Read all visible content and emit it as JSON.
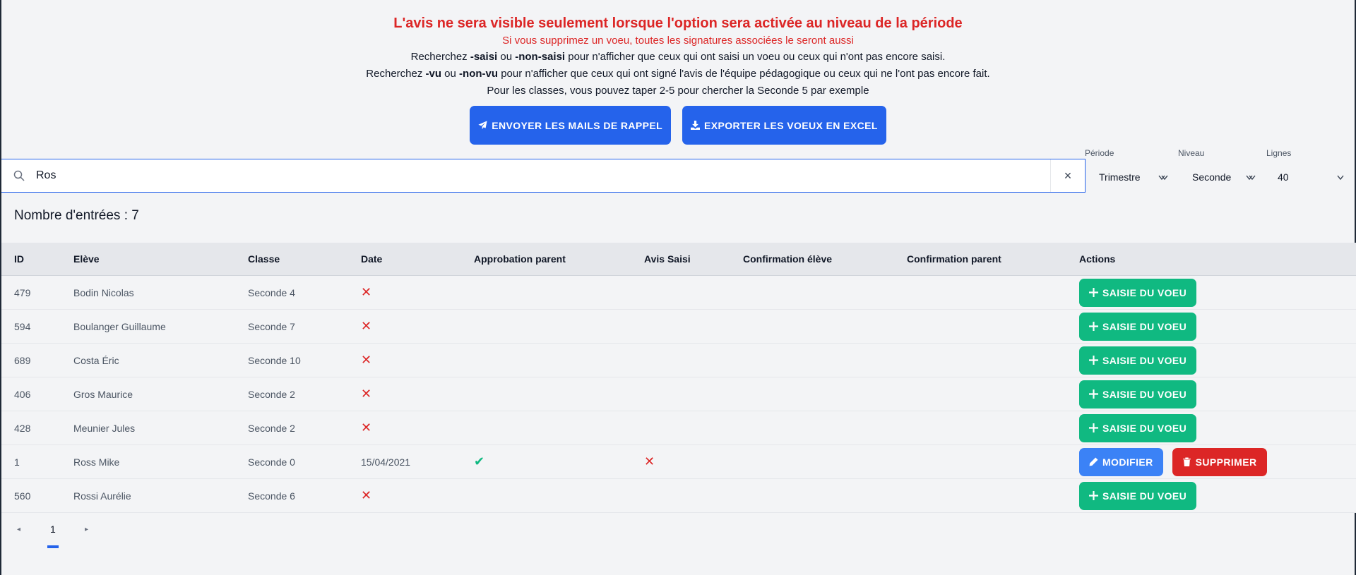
{
  "notice": {
    "title": "L'avis ne sera visible seulement lorsque l'option sera activée au niveau de la période",
    "subtitle": "Si vous supprimez un voeu, toutes les signatures associées le seront aussi",
    "line1": {
      "a": "Recherchez ",
      "b": "-saisi",
      "c": " ou ",
      "d": "-non-saisi",
      "e": " pour n'afficher que ceux qui ont saisi un voeu ou ceux qui n'ont pas encore saisi."
    },
    "line2": {
      "a": "Recherchez ",
      "b": "-vu",
      "c": " ou ",
      "d": "-non-vu",
      "e": " pour n'afficher que ceux qui ont signé l'avis de l'équipe pédagogique ou ceux qui ne l'ont pas encore fait."
    },
    "line3": "Pour les classes, vous pouvez taper 2-5 pour chercher la Seconde 5 par exemple"
  },
  "buttons": {
    "send_reminders": "ENVOYER LES MAILS DE RAPPEL",
    "export_excel": "EXPORTER LES VOEUX EN EXCEL"
  },
  "search": {
    "value": "Ros",
    "clear": "×"
  },
  "filters": {
    "periode": {
      "label": "Période",
      "value": "Trimestre"
    },
    "niveau": {
      "label": "Niveau",
      "value": "Seconde"
    },
    "lignes": {
      "label": "Lignes",
      "value": "40"
    }
  },
  "count_text": "Nombre d'entrées : 7",
  "table": {
    "headers": [
      "ID",
      "Elève",
      "Classe",
      "Date",
      "Approbation parent",
      "Avis Saisi",
      "Confirmation élève",
      "Confirmation parent",
      "Actions"
    ],
    "rows": [
      {
        "id": "479",
        "eleve": "Bodin Nicolas",
        "classe": "Seconde 4",
        "date": ""
      },
      {
        "id": "594",
        "eleve": "Boulanger Guillaume",
        "classe": "Seconde 7",
        "date": ""
      },
      {
        "id": "689",
        "eleve": "Costa Éric",
        "classe": "Seconde 10",
        "date": ""
      },
      {
        "id": "406",
        "eleve": "Gros Maurice",
        "classe": "Seconde 2",
        "date": ""
      },
      {
        "id": "428",
        "eleve": "Meunier Jules",
        "classe": "Seconde 2",
        "date": ""
      },
      {
        "id": "1",
        "eleve": "Ross Mike",
        "classe": "Seconde 0",
        "date": "15/04/2021"
      },
      {
        "id": "560",
        "eleve": "Rossi Aurélie",
        "classe": "Seconde 6",
        "date": ""
      }
    ],
    "action_add": "SAISIE DU VOEU",
    "action_edit": "MODIFIER",
    "action_delete": "SUPPRIMER"
  },
  "pagination": {
    "prev": "◂",
    "page": "1",
    "next": "▸"
  },
  "colors": {
    "primary": "#2563eb",
    "success": "#10b981",
    "danger": "#dc2626",
    "edit": "#3b82f6"
  },
  "icons": [
    "paper-plane-icon",
    "download-icon",
    "search-icon",
    "clear-icon",
    "chevron-down-icon",
    "x-mark-icon",
    "check-icon",
    "plus-icon",
    "pencil-icon",
    "trash-icon"
  ]
}
